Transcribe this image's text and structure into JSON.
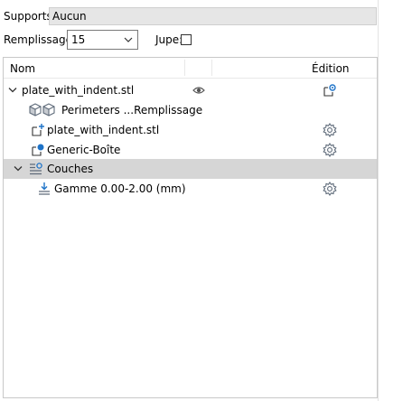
{
  "supports": {
    "label": "Supports:",
    "value": "Aucun"
  },
  "infill": {
    "label": "Remplissage:",
    "value": "15"
  },
  "skirt": {
    "label": "Jupe:",
    "checked": false
  },
  "tree": {
    "columns": {
      "name": "Nom",
      "edit": "Édition"
    },
    "rows": [
      {
        "label": "plate_with_indent.stl",
        "icon": "object-icon",
        "expanded": true,
        "trailing": "eye-icon",
        "edit": "add-settings-icon"
      },
      {
        "label": "Perimeters ...Remplissage",
        "icon": "settings-cube-icons"
      },
      {
        "label": "plate_with_indent.stl",
        "icon": "add-part-icon",
        "edit": "gear-icon"
      },
      {
        "label": "Generic-Boîte",
        "icon": "modifier-icon",
        "edit": "gear-icon"
      },
      {
        "label": "Couches",
        "icon": "layers-icon",
        "expanded": true,
        "selected": true
      },
      {
        "label": "Gamme 0.00-2.00 (mm)",
        "icon": "layer-range-icon",
        "edit": "gear-icon"
      }
    ]
  },
  "colors": {
    "accent_blue": "#1e73c8",
    "selection": "#d6d6d6",
    "icon_gray": "#5f6b7a"
  }
}
